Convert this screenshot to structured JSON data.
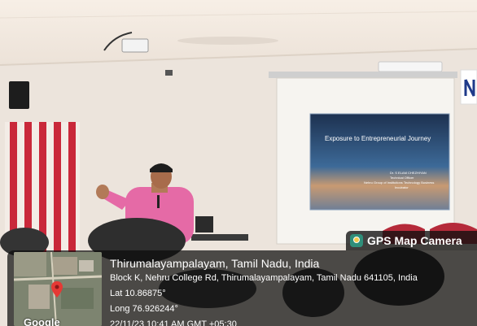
{
  "stamp": {
    "app_name": "GPS Map Camera",
    "place": "Thirumalayampalayam, Tamil Nadu, India",
    "address": "Block K, Nehru College Rd, Thirumalayampalayam, Tamil Nadu 641105, India",
    "lat": "Lat 10.86875°",
    "long": "Long 76.926244°",
    "datetime": "22/11/23 10:41 AM GMT +05:30",
    "map_label": "Google"
  },
  "slide": {
    "title": "Exposure to Entrepreneurial Journey",
    "presenter": "Dr. S ELAM CHEZHIYAN",
    "role": "Technical Officer",
    "org": "Nehru Group of Institutions Technology Business",
    "org2": "Incubator"
  }
}
